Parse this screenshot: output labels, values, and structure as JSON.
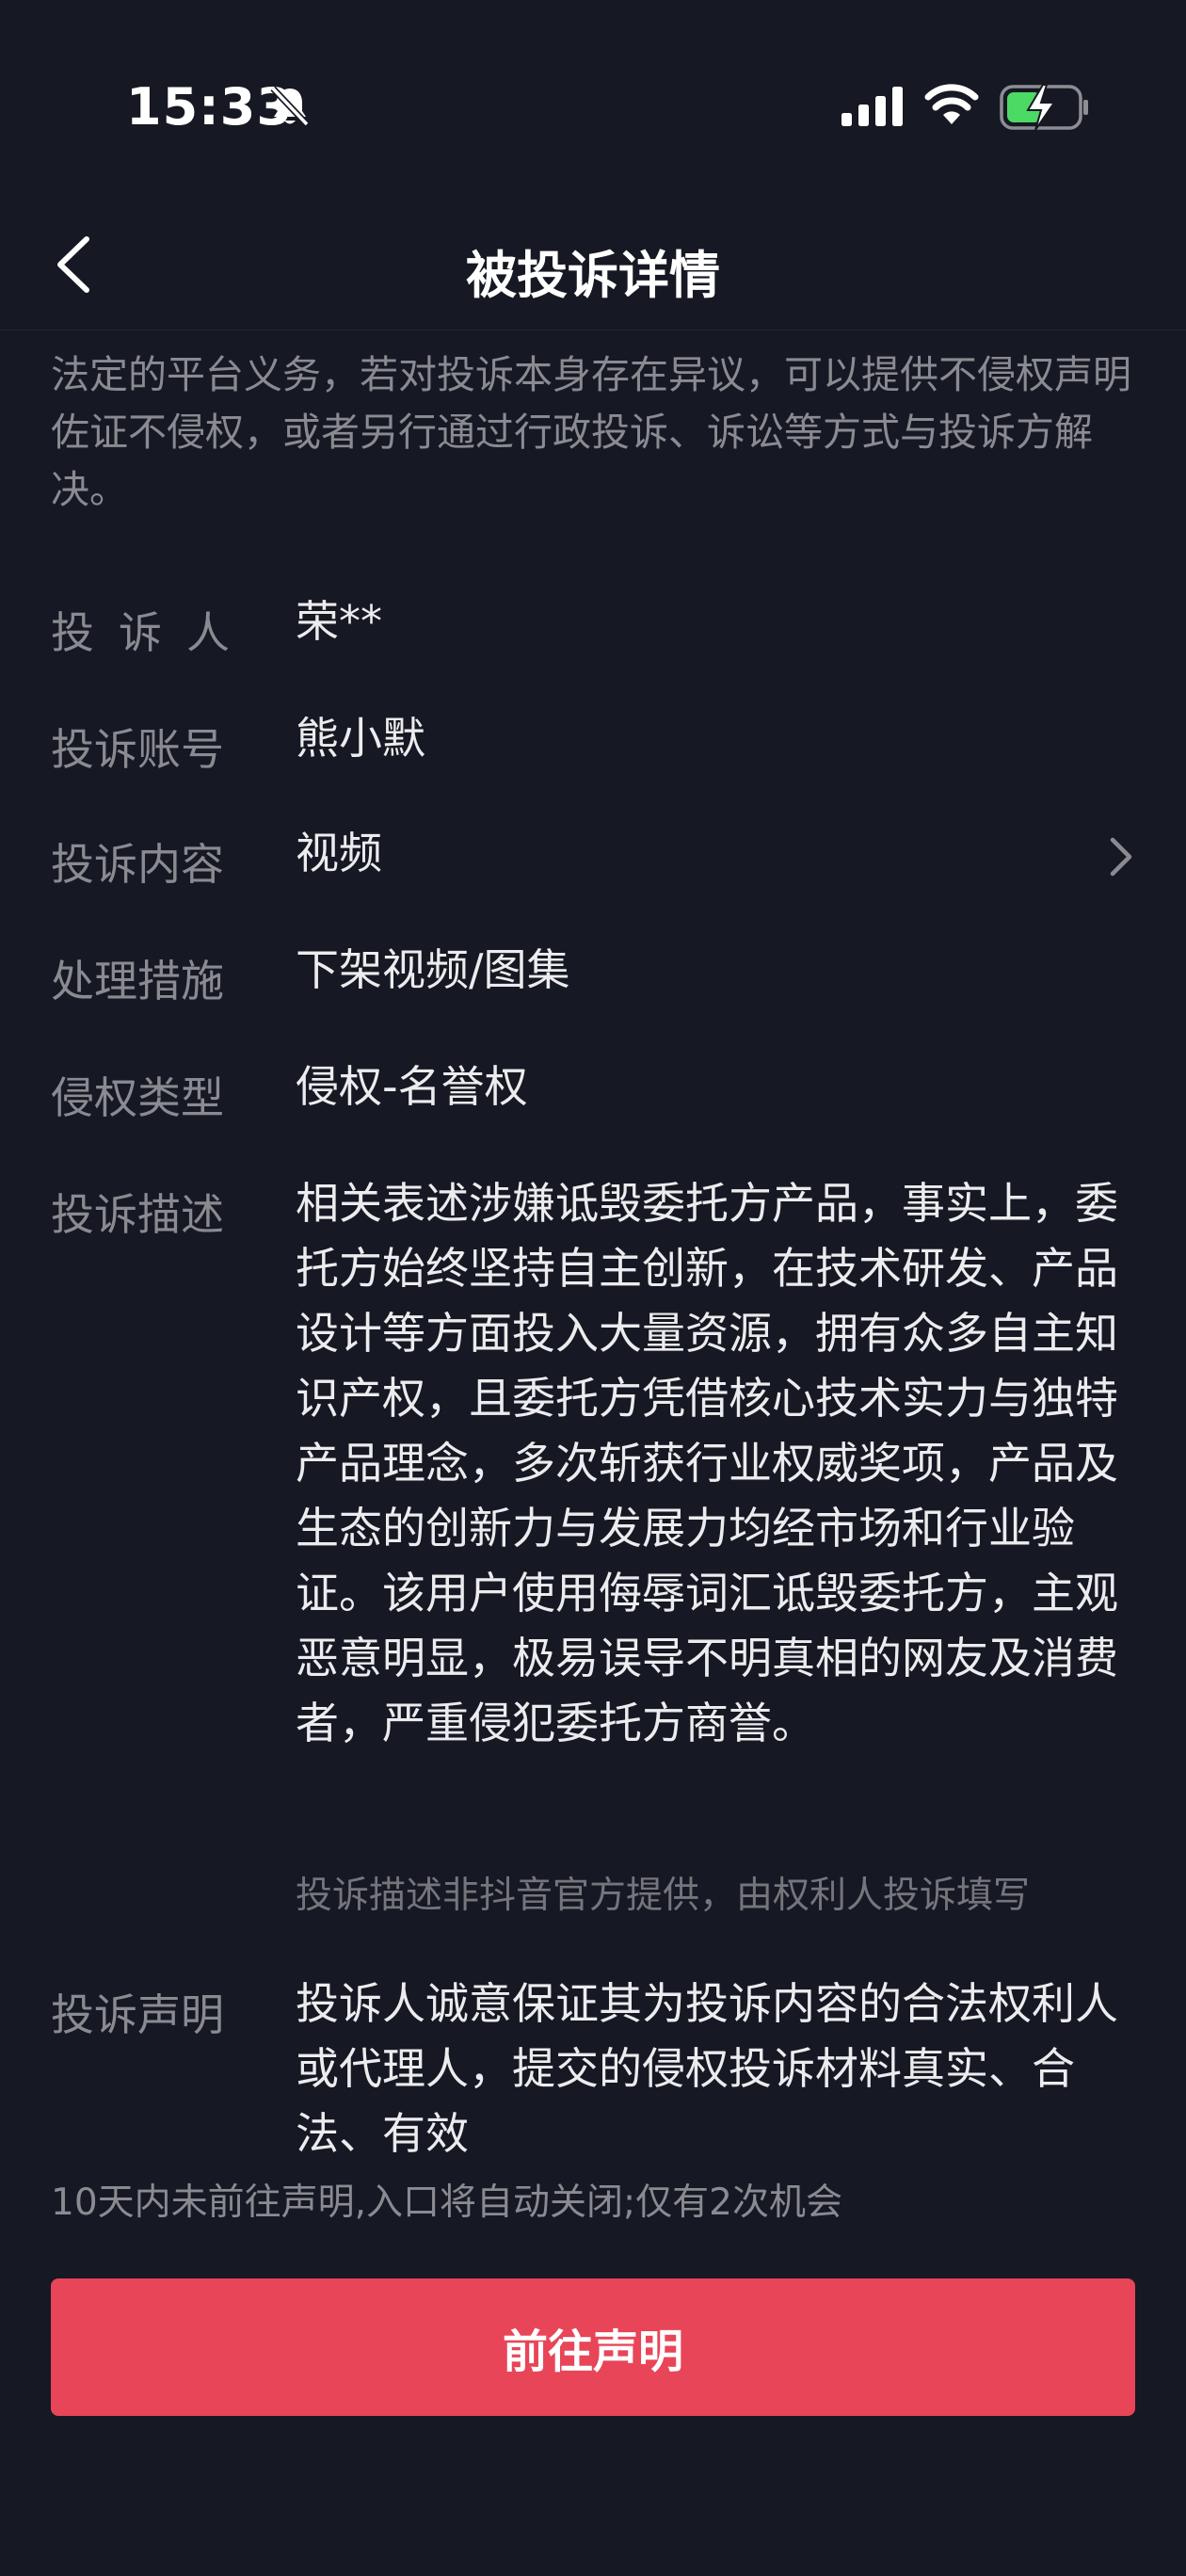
{
  "status_bar": {
    "time": "15:33",
    "icons": [
      "bell-muted-icon",
      "cellular-signal-icon",
      "wifi-icon",
      "battery-charging-icon"
    ]
  },
  "nav": {
    "title": "被投诉详情",
    "back_icon": "chevron-left-icon"
  },
  "intro_text": "法定的平台义务，若对投诉本身存在异议，可以提供不侵权声明佐证不侵权，或者另行通过行政投诉、诉讼等方式与投诉方解决。",
  "details": [
    {
      "label": "投诉人",
      "value": "荣**"
    },
    {
      "label": "投诉账号",
      "value": "熊小默"
    },
    {
      "label": "投诉内容",
      "value": "视频"
    },
    {
      "label": "处理措施",
      "value": "下架视频/图集"
    },
    {
      "label": "侵权类型",
      "value": "侵权-名誉权"
    },
    {
      "label": "投诉描述",
      "value": "相关表述涉嫌诋毁委托方产品，事实上，委托方始终坚持自主创新，在技术研发、产品设计等方面投入大量资源，拥有众多自主知识产权，且委托方凭借核心技术实力与独特产品理念，多次斩获行业权威奖项，产品及生态的创新力与发展力均经市场和行业验证。该用户使用侮辱词汇诋毁委托方，主观恶意明显，极易误导不明真相的网友及消费者，严重侵犯委托方商誉。"
    },
    {
      "label": "投诉声明",
      "value": "投诉人诚意保证其为投诉内容的合法权利人或代理人，提交的侵权投诉材料真实、合法、有效"
    }
  ],
  "description_source_note": "投诉描述非抖音官方提供，由权利人投诉填写",
  "deadline_note": "10天内未前往声明,入口将自动关闭;仅有2次机会",
  "cta_label": "前往声明",
  "colors": {
    "background": "#161823",
    "accent": "#e84558",
    "label": "#8a8b91",
    "value": "#ececef",
    "battery_charge": "#4cd964"
  }
}
